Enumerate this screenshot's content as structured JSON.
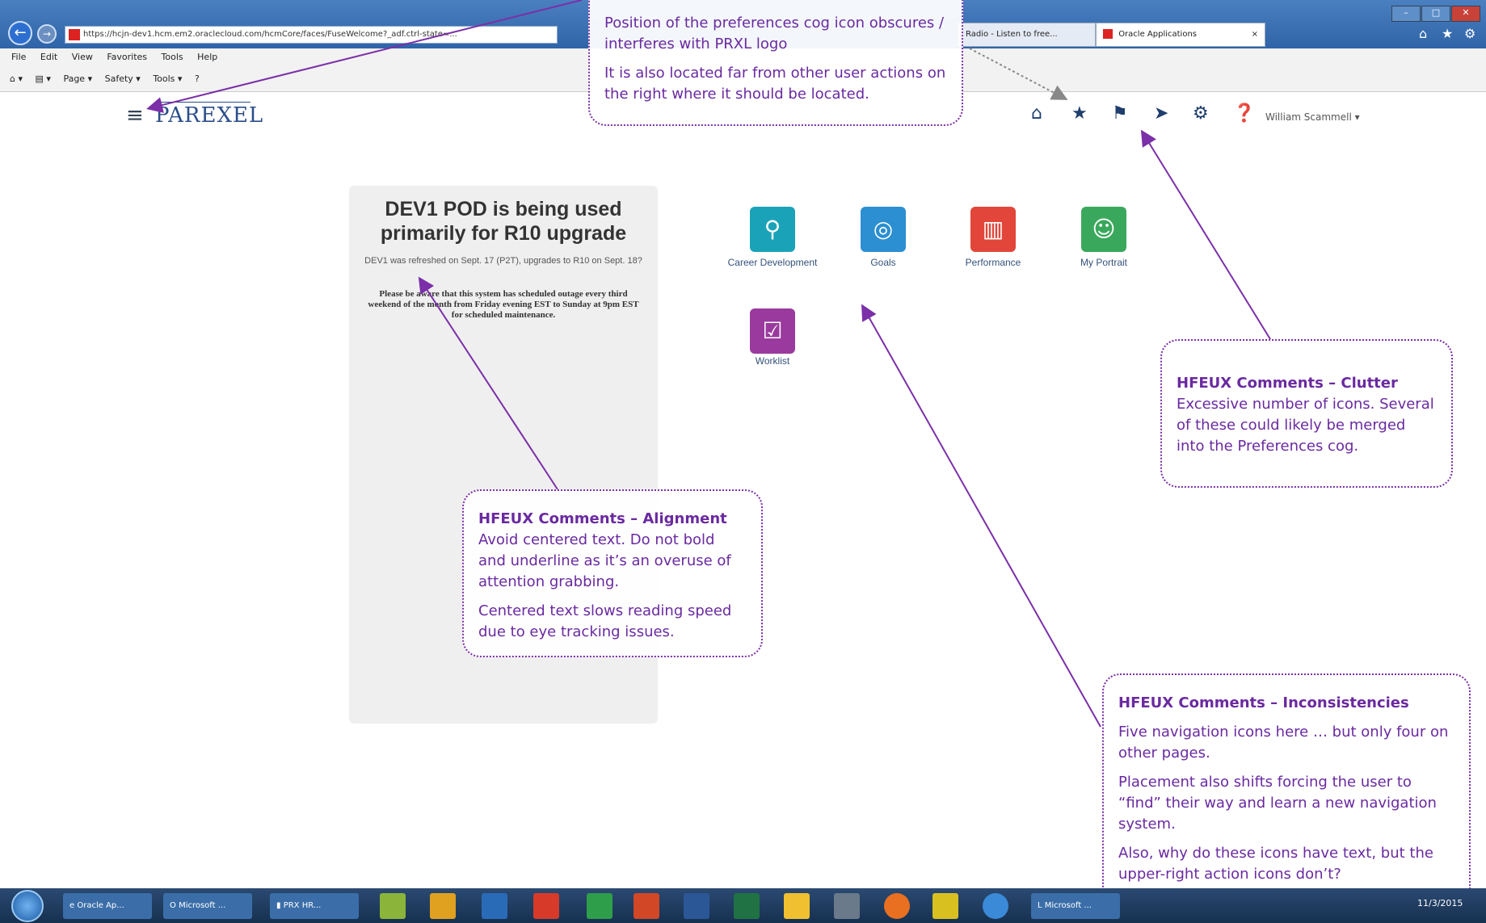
{
  "browser": {
    "url": "https://hcjn-dev1.hcm.em2.oraclecloud.com/hcmCore/faces/FuseWelcome?_adf.ctrl-state=...",
    "tabs": [
      {
        "label": "Radio - Listen to free..."
      },
      {
        "label": "Oracle Applications"
      }
    ],
    "tab_close": "×",
    "window_controls": [
      "–",
      "□",
      "✕"
    ],
    "menu": [
      "File",
      "Edit",
      "View",
      "Favorites",
      "Tools",
      "Help"
    ],
    "commands": [
      "Page ▾",
      "Safety ▾",
      "Tools ▾"
    ]
  },
  "app": {
    "menu_icon": "hamburger-icon",
    "logo": "PAREXEL",
    "user_name": "William Scammell ▾",
    "nav_icons": [
      "home-icon",
      "star-icon",
      "flag-icon",
      "bird-icon",
      "gear-icon",
      "help-icon"
    ]
  },
  "notice": {
    "title": "DEV1 POD is being used primarily for R10 upgrade",
    "body": "DEV1 was refreshed on Sept. 17 (P2T), upgrades to R10 on Sept. 18?",
    "warning": "Please be aware that this system has scheduled outage every third weekend of the month from Friday evening EST to Sunday at 9pm EST for scheduled maintenance."
  },
  "tiles": [
    {
      "label": "Career Development",
      "icon": "signpost-icon",
      "color": "#1aa3b8"
    },
    {
      "label": "Goals",
      "icon": "goals-icon",
      "color": "#2b8fd1"
    },
    {
      "label": "Performance",
      "icon": "chart-icon",
      "color": "#e2463a"
    },
    {
      "label": "My Portrait",
      "icon": "portrait-icon",
      "color": "#3aa85c"
    },
    {
      "label": "Worklist",
      "icon": "clipboard-icon",
      "color": "#9a3a9e"
    }
  ],
  "callouts": {
    "cog": {
      "line1": "Position of the preferences cog icon obscures / interferes with PRXL logo",
      "line2": "It is also located far from other user actions on the right where it should be located."
    },
    "clutter": {
      "heading": "HFEUX Comments – Clutter",
      "body": "Excessive number of icons. Several of these could likely be merged into the Preferences cog."
    },
    "alignment": {
      "heading": "HFEUX Comments – Alignment",
      "body": "Avoid centered text. Do not bold and underline as it’s an overuse of attention grabbing.",
      "body2": "Centered text slows reading speed due to eye tracking issues."
    },
    "inconsistencies": {
      "heading": "HFEUX Comments – Inconsistencies",
      "p1": "Five navigation icons here …  but only four on other pages.",
      "p2": "Placement also shifts forcing the user to “find” their way and learn a new navigation system.",
      "p3": "Also, why do these icons have text, but the upper-right action icons don’t?"
    }
  },
  "taskbar": {
    "apps": [
      "Oracle Ap...",
      "Microsoft ...",
      "PRX HR...",
      "Microsoft ..."
    ],
    "clock": "11/3/2015"
  },
  "colors": {
    "annotation": "#6a2aa0",
    "arrow": "#7b2fa8"
  }
}
